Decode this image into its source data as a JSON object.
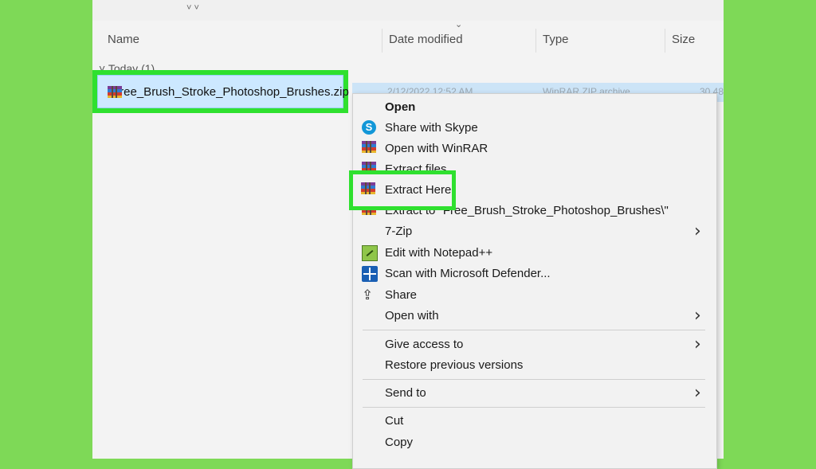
{
  "columns": {
    "name": "Name",
    "date_modified": "Date modified",
    "type": "Type",
    "size": "Size"
  },
  "group_label": "Today (1)",
  "file": {
    "name": "Free_Brush_Stroke_Photoshop_Brushes.zip",
    "date_faded": "2/12/2022 12:52 AM",
    "type_faded": "WinRAR ZIP archive",
    "size_faded": "30,48",
    "icon": "winrar-archive-icon"
  },
  "context_menu": {
    "items": [
      {
        "label": "Open",
        "icon": "",
        "bold": true
      },
      {
        "label": "Share with Skype",
        "icon": "skype-icon"
      },
      {
        "label": "Open with WinRAR",
        "icon": "winrar-icon"
      },
      {
        "label": "Extract files...",
        "icon": "winrar-icon"
      },
      {
        "label": "Extract Here",
        "icon": "winrar-icon",
        "highlighted": true
      },
      {
        "label": "Extract to \"Free_Brush_Stroke_Photoshop_Brushes\\\"",
        "icon": "winrar-icon"
      },
      {
        "label": "7-Zip",
        "icon": "",
        "submenu": true
      },
      {
        "label": "Edit with Notepad++",
        "icon": "notepad-plus-plus-icon"
      },
      {
        "label": "Scan with Microsoft Defender...",
        "icon": "defender-icon"
      },
      {
        "label": "Share",
        "icon": "share-icon"
      },
      {
        "label": "Open with",
        "icon": "",
        "submenu": true
      },
      {
        "label": "Give access to",
        "icon": "",
        "submenu": true
      },
      {
        "label": "Restore previous versions",
        "icon": ""
      },
      {
        "label": "Send to",
        "icon": "",
        "submenu": true
      },
      {
        "label": "Cut",
        "icon": ""
      },
      {
        "label": "Copy",
        "icon": ""
      }
    ]
  },
  "colors": {
    "background": "#7ed957",
    "highlight": "#2fe02f",
    "selection": "#cce8ff"
  }
}
